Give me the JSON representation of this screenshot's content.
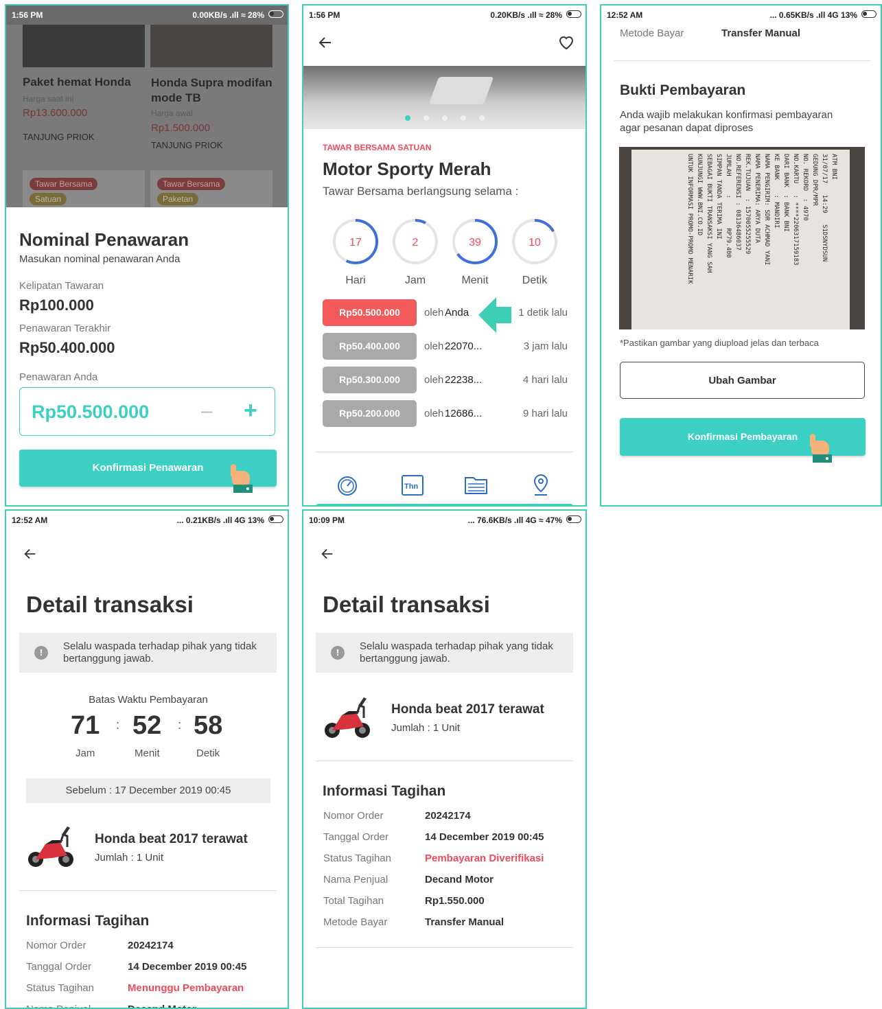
{
  "colors": {
    "accent": "#3ccfc4",
    "border": "#3ccfb6",
    "red": "#ef4b5b",
    "gray_pill": "#a9a9a9"
  },
  "screen1": {
    "status": {
      "time": "1:56 PM",
      "right": "0.00KB/s .ıll ≈ 28%"
    },
    "cards": [
      {
        "title": "Paket hemat Honda",
        "price_label": "Harga saat ini",
        "price": "Rp13.600.000",
        "location": "TANJUNG PRIOK"
      },
      {
        "title": "Honda Supra modifan mode TB",
        "price_label": "Harga awal",
        "price": "Rp1.500.000",
        "location": "TANJUNG PRIOK"
      }
    ],
    "tags": [
      {
        "tag": "Tawar Bersama",
        "sub": "Satuan"
      },
      {
        "tag": "Tawar Bersama",
        "sub": "Paketan"
      }
    ],
    "sheet": {
      "title": "Nominal Penawaran",
      "subtitle": "Masukan nominal penawaran Anda",
      "kelipatan_label": "Kelipatan Tawaran",
      "kelipatan_value": "Rp100.000",
      "terakhir_label": "Penawaran Terakhir",
      "terakhir_value": "Rp50.400.000",
      "anda_label": "Penawaran Anda",
      "anda_value": "Rp50.500.000",
      "minus": "–",
      "plus": "+",
      "confirm": "Konfirmasi Penawaran"
    }
  },
  "screen2": {
    "status": {
      "time": "1:56 PM",
      "right": "0.20KB/s .ıll ≈ 28%"
    },
    "icons": {
      "back": "arrow-left-icon",
      "favorite": "heart-icon"
    },
    "tag": "TAWAR BERSAMA SATUAN",
    "title": "Motor Sporty Merah",
    "subtitle": "Tawar Bersama berlangsung selama :",
    "countdown": [
      {
        "value": "17",
        "label": "Hari",
        "fraction": 0.57
      },
      {
        "value": "2",
        "label": "Jam",
        "fraction": 0.08
      },
      {
        "value": "39",
        "label": "Menit",
        "fraction": 0.65
      },
      {
        "value": "10",
        "label": "Detik",
        "fraction": 0.17
      }
    ],
    "bids": [
      {
        "amount": "Rp50.500.000",
        "by": "oleh",
        "name": "Anda",
        "time": "1 detik lalu",
        "highlight": true
      },
      {
        "amount": "Rp50.400.000",
        "by": "oleh",
        "name": "22070...",
        "time": "3 jam lalu",
        "highlight": false
      },
      {
        "amount": "Rp50.300.000",
        "by": "oleh",
        "name": "22238...",
        "time": "4 hari lalu",
        "highlight": false
      },
      {
        "amount": "Rp50.200.000",
        "by": "oleh",
        "name": "12686...",
        "time": "9 hari lalu",
        "highlight": false
      }
    ],
    "bottom_icons": [
      "speedometer-icon",
      "calendar-icon",
      "document-icon",
      "location-pin-icon"
    ],
    "calendar_text": "Thn",
    "carousel_pages": 5
  },
  "screen3": {
    "status": {
      "time": "12:52 AM",
      "right": "... 0.65KB/s .ıll 4G 13%"
    },
    "metode_label": "Metode Bayar",
    "metode_value": "Transfer Manual",
    "title": "Bukti Pembayaran",
    "desc": "Anda wajib melakukan konfirmasi pembayaran agar pesanan dapat diproses",
    "receipt": [
      "ATM BNI",
      "31/07/17   14:29   S1DSNYDSUN",
      "GEDUNG DPR/MPR",
      "NO. REKORD  : 4970",
      "NO.KARTU   : ****2206317159183",
      "DARI BANK  : BANK BNI",
      "KE BANK    : MANDIRI",
      "NAMA PENGIRIM: SDR ACHMAD YANI",
      "NAMA PENERIMA: ARYA DUTA",
      "REK.TUJUAN  : 1570055255529",
      "NO.REFERENSI : 08136486037",
      "JUMLAH     :        RP79.400",
      "SIMPAN TANDA TERIMA INI",
      "SEBAGAI BUKTI TRANSAKSI YANG SAH",
      "KUNJUNGI WWW.BNI.CO.ID",
      "UNTUK INFORMASI PROMO-PROMO MENARIK"
    ],
    "note": "*Pastikan gambar yang diupload jelas dan terbaca",
    "change_button": "Ubah Gambar",
    "confirm_button": "Konfirmasi Pembayaran"
  },
  "screen4": {
    "status": {
      "time": "12:52 AM",
      "right": "... 0.21KB/s .ıll 4G 13%"
    },
    "title": "Detail transaksi",
    "warning": "Selalu waspada terhadap pihak yang tidak bertanggung jawab.",
    "deadline_label": "Batas Waktu Pembayaran",
    "timer": [
      {
        "value": "71",
        "label": "Jam"
      },
      {
        "value": "52",
        "label": "Menit"
      },
      {
        "value": "58",
        "label": "Detik"
      }
    ],
    "separator": ":",
    "before": "Sebelum : 17 December 2019 00:45",
    "product_name": "Honda beat 2017 terawat",
    "product_qty": "Jumlah : 1 Unit",
    "section_title": "Informasi Tagihan",
    "rows": [
      {
        "label": "Nomor Order",
        "value": "20242174",
        "style": "bold"
      },
      {
        "label": "Tanggal Order",
        "value": "14 December 2019 00:45",
        "style": "bold"
      },
      {
        "label": "Status Tagihan",
        "value": "Menunggu Pembayaran",
        "style": "red"
      },
      {
        "label": "Nama Penjual",
        "value": "Decand Motor",
        "style": "bold"
      }
    ]
  },
  "screen5": {
    "status": {
      "time": "10:09 PM",
      "right": "... 76.6KB/s .ıll 4G ≈ 47%"
    },
    "title": "Detail transaksi",
    "warning": "Selalu waspada terhadap pihak yang tidak bertanggung jawab.",
    "product_name": "Honda beat 2017 terawat",
    "product_qty": "Jumlah : 1 Unit",
    "section_title": "Informasi Tagihan",
    "rows": [
      {
        "label": "Nomor Order",
        "value": "20242174",
        "style": "bold"
      },
      {
        "label": "Tanggal Order",
        "value": "14 December 2019 00:45",
        "style": "bold"
      },
      {
        "label": "Status Tagihan",
        "value": "Pembayaran Diverifikasi",
        "style": "red"
      },
      {
        "label": "Nama Penjual",
        "value": "Decand Motor",
        "style": "bold"
      },
      {
        "label": "Total Tagihan",
        "value": "Rp1.550.000",
        "style": "bold"
      },
      {
        "label": "Metode Bayar",
        "value": "Transfer Manual",
        "style": "bold"
      }
    ]
  }
}
